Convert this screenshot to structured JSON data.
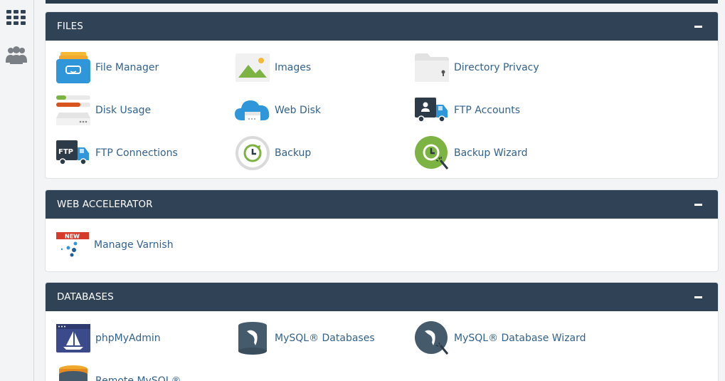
{
  "rail": {
    "apps_icon": "grid-icon",
    "users_icon": "users-icon"
  },
  "sections": {
    "files": {
      "title": "FILES",
      "collapse_icon": "minus-icon",
      "items": [
        {
          "label": "File Manager",
          "icon": "file-manager-icon"
        },
        {
          "label": "Images",
          "icon": "images-icon"
        },
        {
          "label": "Directory Privacy",
          "icon": "directory-privacy-icon"
        },
        {
          "label": "Disk Usage",
          "icon": "disk-usage-icon"
        },
        {
          "label": "Web Disk",
          "icon": "web-disk-icon"
        },
        {
          "label": "FTP Accounts",
          "icon": "ftp-accounts-icon"
        },
        {
          "label": "FTP Connections",
          "icon": "ftp-connections-icon"
        },
        {
          "label": "Backup",
          "icon": "backup-icon"
        },
        {
          "label": "Backup Wizard",
          "icon": "backup-wizard-icon"
        }
      ]
    },
    "web_accelerator": {
      "title": "WEB ACCELERATOR",
      "collapse_icon": "minus-icon",
      "items": [
        {
          "label": "Manage Varnish",
          "icon": "varnish-icon",
          "badge": "NEW"
        }
      ]
    },
    "databases": {
      "title": "DATABASES",
      "collapse_icon": "minus-icon",
      "items": [
        {
          "label": "phpMyAdmin",
          "icon": "phpmyadmin-icon"
        },
        {
          "label": "MySQL® Databases",
          "icon": "mysql-databases-icon"
        },
        {
          "label": "MySQL® Database Wizard",
          "icon": "mysql-wizard-icon"
        },
        {
          "label": "Remote MySQL®",
          "icon": "remote-mysql-icon"
        }
      ]
    }
  },
  "colors": {
    "header_bg": "#2f4256",
    "link": "#32628d",
    "page_bg": "#f3f4f5"
  }
}
